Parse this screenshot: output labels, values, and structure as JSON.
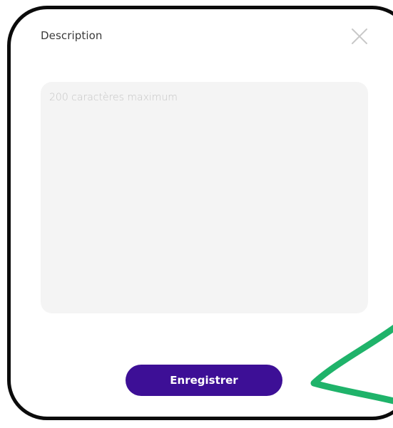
{
  "dialog": {
    "title": "Description",
    "close_icon": "close-icon",
    "textarea": {
      "value": "",
      "placeholder": "200 caractères maximum"
    },
    "save_label": "Enregistrer"
  },
  "colors": {
    "primary": "#3d0f96",
    "textarea_bg": "#f4f4f4",
    "annotation": "#1fb36a",
    "frame": "#0b0b0b"
  }
}
